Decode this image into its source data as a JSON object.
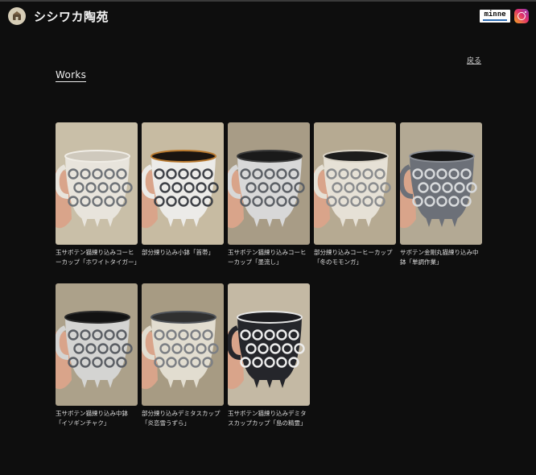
{
  "header": {
    "site_title": "シシワカ陶苑",
    "logo_icon": "kiln-logo-icon",
    "minne_label": "minne",
    "instagram_icon": "instagram-icon"
  },
  "nav": {
    "back_label": "戻る"
  },
  "section": {
    "title": "Works"
  },
  "works": [
    {
      "caption": "玉サボテン猫練り込みコーヒーカップ「ホワイトタイガー」",
      "bg": "#c9bfa8",
      "cup": "#e8e4dc",
      "pattern": "#6f7378",
      "rim": "#f0ede6",
      "interior": "#cfc9bd"
    },
    {
      "caption": "部分練り込み小鉢「首帯」",
      "bg": "#c7bba2",
      "cup": "#ecebe8",
      "pattern": "#3d4046",
      "rim": "#b9792e",
      "interior": "#1a1410"
    },
    {
      "caption": "玉サボテン猫練り込みコーヒーカップ「墨流し」",
      "bg": "#a89c86",
      "cup": "#d8d8d8",
      "pattern": "#5c6066",
      "rim": "#3c3c3c",
      "interior": "#1a1a1a"
    },
    {
      "caption": "部分練り込みコーヒーカップ「冬のモモンガ」",
      "bg": "#b6aa92",
      "cup": "#e6e1d6",
      "pattern": "#8a8c8e",
      "rim": "#d9d3c6",
      "interior": "#1c1c1c"
    },
    {
      "caption": "サボテン金剛丸猫練り込み中鉢「単調作業」",
      "bg": "#b3a994",
      "cup": "#6c7078",
      "pattern": "#d8dadc",
      "rim": "#8b8f96",
      "interior": "#141414"
    },
    {
      "caption": "玉サボテン猫練り込み中鉢「イソギンチャク」",
      "bg": "#aca18a",
      "cup": "#d4d4d2",
      "pattern": "#5a5e64",
      "rim": "#2a2a2a",
      "interior": "#121212"
    },
    {
      "caption": "部分練り込みデミタスカップ「炎恋雪うずら」",
      "bg": "#a79b83",
      "cup": "#e2ddd0",
      "pattern": "#7c7f84",
      "rim": "#50545a",
      "interior": "#303030"
    },
    {
      "caption": "玉サボテン猫練り込みデミタスカップカップ「島の精霊」",
      "bg": "#c4b9a4",
      "cup": "#25262b",
      "pattern": "#ededed",
      "rim": "#e6e6e6",
      "interior": "#1c1c20"
    }
  ]
}
